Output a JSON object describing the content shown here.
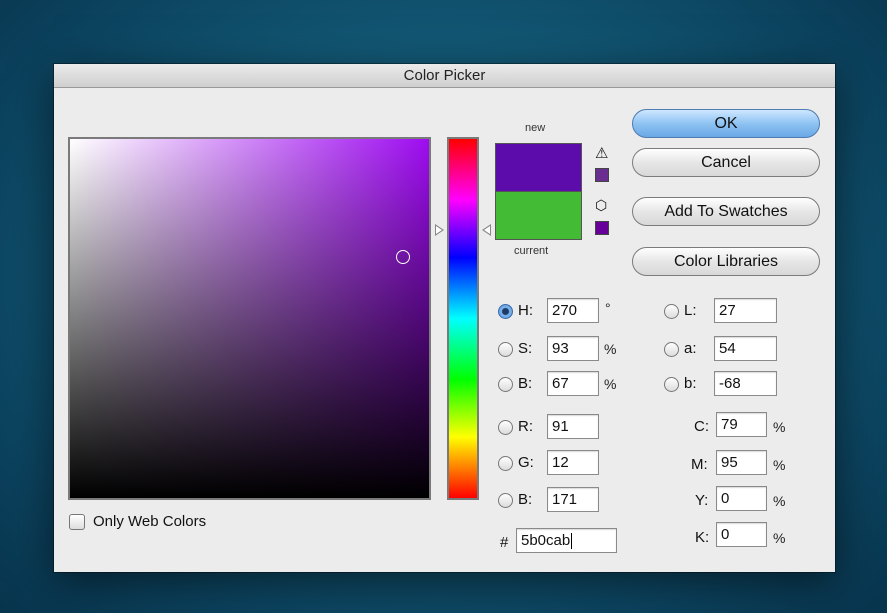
{
  "window": {
    "title": "Color Picker"
  },
  "swatch": {
    "new_label": "new",
    "current_label": "current",
    "new_color": "#5b0cab",
    "current_color": "#43bb35",
    "gamut_warning_color": "#6a2e91",
    "web_safe_color": "#660099"
  },
  "buttons": {
    "ok": "OK",
    "cancel": "Cancel",
    "add_to_swatches": "Add To Swatches",
    "color_libraries": "Color Libraries"
  },
  "hsb": {
    "h_label": "H:",
    "h_value": "270",
    "h_unit": "°",
    "s_label": "S:",
    "s_value": "93",
    "s_unit": "%",
    "b_label": "B:",
    "b_value": "67",
    "b_unit": "%"
  },
  "rgb": {
    "r_label": "R:",
    "r_value": "91",
    "g_label": "G:",
    "g_value": "12",
    "b_label": "B:",
    "b_value": "171"
  },
  "lab": {
    "l_label": "L:",
    "l_value": "27",
    "a_label": "a:",
    "a_value": "54",
    "b_label": "b:",
    "b_value": "-68"
  },
  "cmyk": {
    "c_label": "C:",
    "c_value": "79",
    "c_unit": "%",
    "m_label": "M:",
    "m_value": "95",
    "m_unit": "%",
    "y_label": "Y:",
    "y_value": "0",
    "y_unit": "%",
    "k_label": "K:",
    "k_value": "0",
    "k_unit": "%"
  },
  "hex": {
    "label": "#",
    "value": "5b0cab"
  },
  "options": {
    "only_web_colors": "Only Web Colors"
  },
  "icons": {
    "gamut_warning": "warning-triangle-icon",
    "web_safe": "cube-icon"
  }
}
